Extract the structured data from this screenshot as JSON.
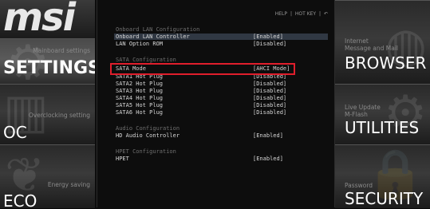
{
  "brand": {
    "logo": "msi"
  },
  "left_tiles": [
    {
      "subtitle": "Mainboard settings",
      "title": "SETTINGS",
      "icon": "settings-icon",
      "active": true
    },
    {
      "subtitle": "Overclocking setting",
      "title": "OC",
      "icon": "oc-icon",
      "active": false
    },
    {
      "subtitle": "Energy saving",
      "title": "ECO",
      "icon": "eco-leaf-icon",
      "active": false
    }
  ],
  "right_tiles": [
    {
      "subtitle": "Internet\nMessage and Mail",
      "title": "BROWSER",
      "icon": "globe-icon"
    },
    {
      "subtitle": "Live Update\nM-Flash",
      "title": "UTILITIES",
      "icon": "gear-icon"
    },
    {
      "subtitle": "Password",
      "title": "SECURITY",
      "icon": "lock-icon"
    }
  ],
  "topbar": {
    "help": "HELP",
    "hotkey": "HOT KEY",
    "sep": "|",
    "back_icon": "back-icon",
    "back": "↶"
  },
  "sections": [
    {
      "title": "Onboard LAN Configuration",
      "items": [
        {
          "label": "Onboard LAN Controller",
          "value": "[Enabled]",
          "highlight": true
        },
        {
          "label": "LAN Option ROM",
          "value": "[Disabled]"
        }
      ]
    },
    {
      "title": "SATA Configuration",
      "items": [
        {
          "label": "SATA Mode",
          "value": "[AHCI Mode]",
          "selected": true
        },
        {
          "label": "SATA1 Hot Plug",
          "value": "[Disabled]"
        },
        {
          "label": "SATA2 Hot Plug",
          "value": "[Disabled]"
        },
        {
          "label": "SATA3 Hot Plug",
          "value": "[Disabled]"
        },
        {
          "label": "SATA4 Hot Plug",
          "value": "[Disabled]"
        },
        {
          "label": "SATA5 Hot Plug",
          "value": "[Disabled]"
        },
        {
          "label": "SATA6 Hot Plug",
          "value": "[Disabled]"
        }
      ]
    },
    {
      "title": "Audio Configuration",
      "items": [
        {
          "label": "HD Audio Controller",
          "value": "[Enabled]"
        }
      ]
    },
    {
      "title": "HPET Configuration",
      "items": [
        {
          "label": "HPET",
          "value": "[Enabled]"
        }
      ]
    }
  ],
  "colors": {
    "selection": "#e01e2c",
    "highlight_row": "#303843",
    "text": "#d8d8d8",
    "section_title": "#6f6f6f"
  }
}
